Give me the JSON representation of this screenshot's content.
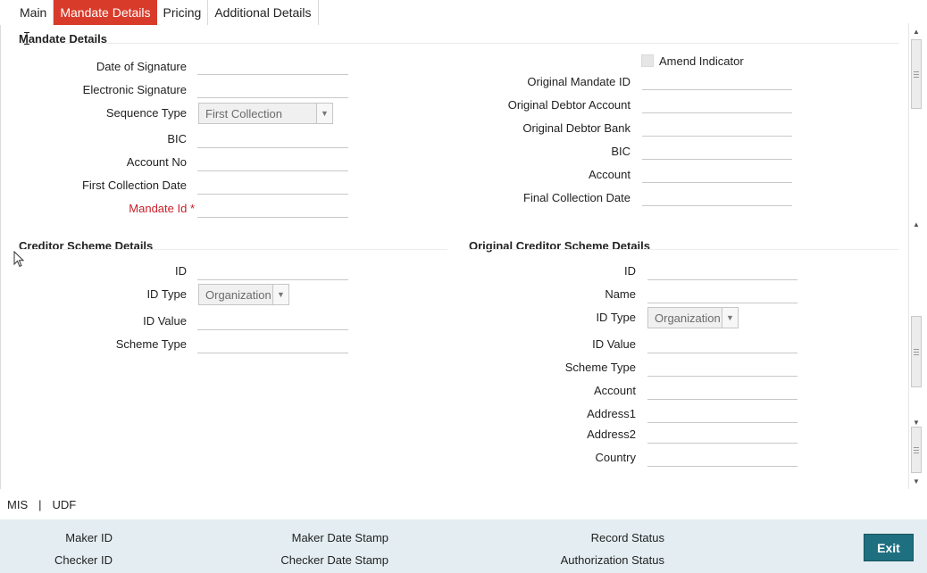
{
  "tabs": [
    {
      "label": "Main",
      "active": false
    },
    {
      "label": "Mandate Details",
      "active": true
    },
    {
      "label": "Pricing",
      "active": false
    },
    {
      "label": "Additional Details",
      "active": false
    }
  ],
  "mandate": {
    "title": "Mandate Details",
    "date_of_signature": "Date of Signature",
    "electronic_signature": "Electronic Signature",
    "sequence_type": "Sequence Type",
    "sequence_type_value": "First Collection",
    "bic": "BIC",
    "account_no": "Account No",
    "first_collection_date": "First Collection Date",
    "mandate_id": "Mandate Id *",
    "amend_indicator": "Amend Indicator",
    "original_mandate_id": "Original Mandate ID",
    "original_debtor_account": "Original Debtor Account",
    "original_debtor_bank": "Original Debtor Bank",
    "right_bic": "BIC",
    "account": "Account",
    "final_collection_date": "Final Collection Date"
  },
  "creditor": {
    "title": "Creditor Scheme Details",
    "id": "ID",
    "id_type": "ID Type",
    "id_type_value": "Organization",
    "id_value": "ID Value",
    "scheme_type": "Scheme Type"
  },
  "original_creditor": {
    "title": "Original Creditor Scheme Details",
    "id": "ID",
    "name": "Name",
    "id_type": "ID Type",
    "id_type_value": "Organization",
    "id_value": "ID Value",
    "scheme_type": "Scheme Type",
    "account": "Account",
    "address1": "Address1",
    "address2": "Address2",
    "country": "Country"
  },
  "links": {
    "mis": "MIS",
    "separator": "|",
    "udf": "UDF"
  },
  "footer": {
    "maker_id": "Maker ID",
    "checker_id": "Checker ID",
    "maker_date_stamp": "Maker Date Stamp",
    "checker_date_stamp": "Checker Date Stamp",
    "record_status": "Record Status",
    "authorization_status": "Authorization Status",
    "exit": "Exit"
  },
  "colors": {
    "active_tab": "#d93b2b",
    "required_label": "#c8202a",
    "footer_bg": "#e4eef2",
    "exit_button": "#1e6f80"
  },
  "icons": {
    "dropdown": "chevron-down-icon",
    "pointer": "mouse-pointer-icon",
    "scroll_up": "arrow-up-icon",
    "scroll_down": "arrow-down-icon"
  }
}
